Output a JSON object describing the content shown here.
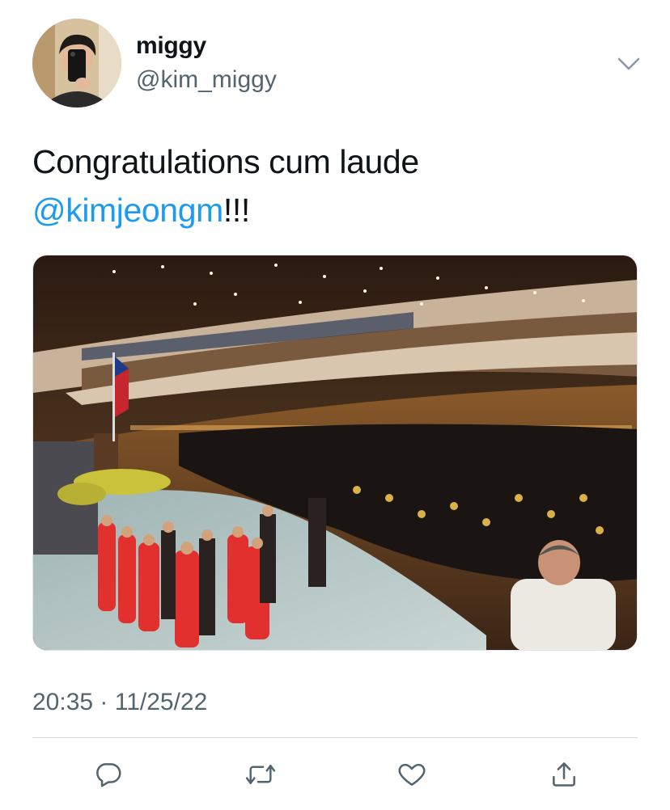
{
  "tweet": {
    "display_name": "miggy",
    "handle": "@kim_miggy",
    "text_line1": "Congratulations cum laude",
    "mention": "@kimjeongm",
    "text_suffix": "!!!",
    "timestamp": "20:35 · 11/25/22"
  },
  "icons": {
    "more": "chevron-down-icon",
    "reply": "reply-icon",
    "retweet": "retweet-icon",
    "like": "heart-icon",
    "share": "share-icon"
  },
  "colors": {
    "link": "#1d9bf0",
    "secondary_text": "#536471",
    "icon": "#536471"
  }
}
